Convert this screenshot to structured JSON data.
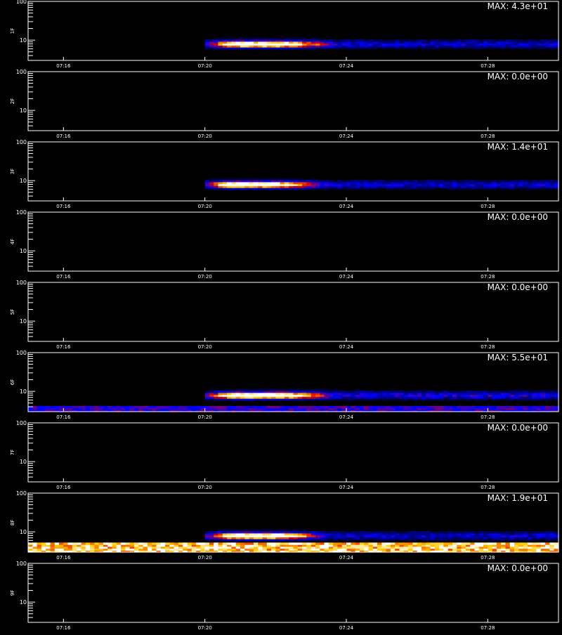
{
  "x_ticks": [
    "07:16",
    "07:20",
    "07:24",
    "07:28"
  ],
  "y_ticks": [
    "100",
    "10"
  ],
  "footer": "",
  "chart_data": [
    {
      "type": "heatmap",
      "ylabel": "1F",
      "max_label": "MAX: 4.3e+01",
      "max": 43,
      "xlim": [
        "07:15:00",
        "07:30:00"
      ],
      "ylim": [
        3,
        100
      ],
      "ylog": true,
      "signal": {
        "start": "07:20:00",
        "peak": "07:21:15",
        "end": "07:23:45",
        "freq": 8
      },
      "baseline": 0.25,
      "band": null
    },
    {
      "type": "heatmap",
      "ylabel": "2F",
      "max_label": "MAX: 0.0e+00",
      "max": 0,
      "xlim": [
        "07:15:00",
        "07:30:00"
      ],
      "ylim": [
        3,
        100
      ],
      "ylog": true,
      "signal": null,
      "baseline": 0,
      "band": null
    },
    {
      "type": "heatmap",
      "ylabel": "3F",
      "max_label": "MAX: 1.4e+01",
      "max": 14,
      "xlim": [
        "07:15:00",
        "07:30:00"
      ],
      "ylim": [
        3,
        100
      ],
      "ylog": true,
      "signal": {
        "start": "07:20:00",
        "peak": "07:21:00",
        "end": "07:23:30",
        "freq": 8
      },
      "baseline": 0.25,
      "band": null
    },
    {
      "type": "heatmap",
      "ylabel": "4F",
      "max_label": "MAX: 0.0e+00",
      "max": 0,
      "xlim": [
        "07:15:00",
        "07:30:00"
      ],
      "ylim": [
        3,
        100
      ],
      "ylog": true,
      "signal": null,
      "baseline": 0,
      "band": null
    },
    {
      "type": "heatmap",
      "ylabel": "5F",
      "max_label": "MAX: 0.0e+00",
      "max": 0,
      "xlim": [
        "07:15:00",
        "07:30:00"
      ],
      "ylim": [
        3,
        100
      ],
      "ylog": true,
      "signal": null,
      "baseline": 0,
      "band": null
    },
    {
      "type": "heatmap",
      "ylabel": "6F",
      "max_label": "MAX: 5.5e+01",
      "max": 55,
      "xlim": [
        "07:15:00",
        "07:30:00"
      ],
      "ylim": [
        3,
        100
      ],
      "ylog": true,
      "signal": {
        "start": "07:20:00",
        "peak": "07:21:20",
        "end": "07:23:45",
        "freq": 8
      },
      "baseline": 0.3,
      "band": {
        "freq": [
          3,
          4
        ],
        "level": 0.35
      }
    },
    {
      "type": "heatmap",
      "ylabel": "7F",
      "max_label": "MAX: 0.0e+00",
      "max": 0,
      "xlim": [
        "07:15:00",
        "07:30:00"
      ],
      "ylim": [
        3,
        100
      ],
      "ylog": true,
      "signal": null,
      "baseline": 0,
      "band": null
    },
    {
      "type": "heatmap",
      "ylabel": "8F",
      "max_label": "MAX: 1.9e+01",
      "max": 19,
      "xlim": [
        "07:15:00",
        "07:30:00"
      ],
      "ylim": [
        3,
        100
      ],
      "ylog": true,
      "signal": {
        "start": "07:20:00",
        "peak": "07:21:15",
        "end": "07:23:30",
        "freq": 8
      },
      "baseline": 0.25,
      "band": {
        "freq": [
          3,
          5
        ],
        "level": 0.85
      }
    },
    {
      "type": "heatmap",
      "ylabel": "9F",
      "max_label": "MAX: 0.0e+00",
      "max": 0,
      "xlim": [
        "07:15:00",
        "07:30:00"
      ],
      "ylim": [
        3,
        100
      ],
      "ylog": true,
      "signal": null,
      "baseline": 0,
      "band": null
    }
  ]
}
